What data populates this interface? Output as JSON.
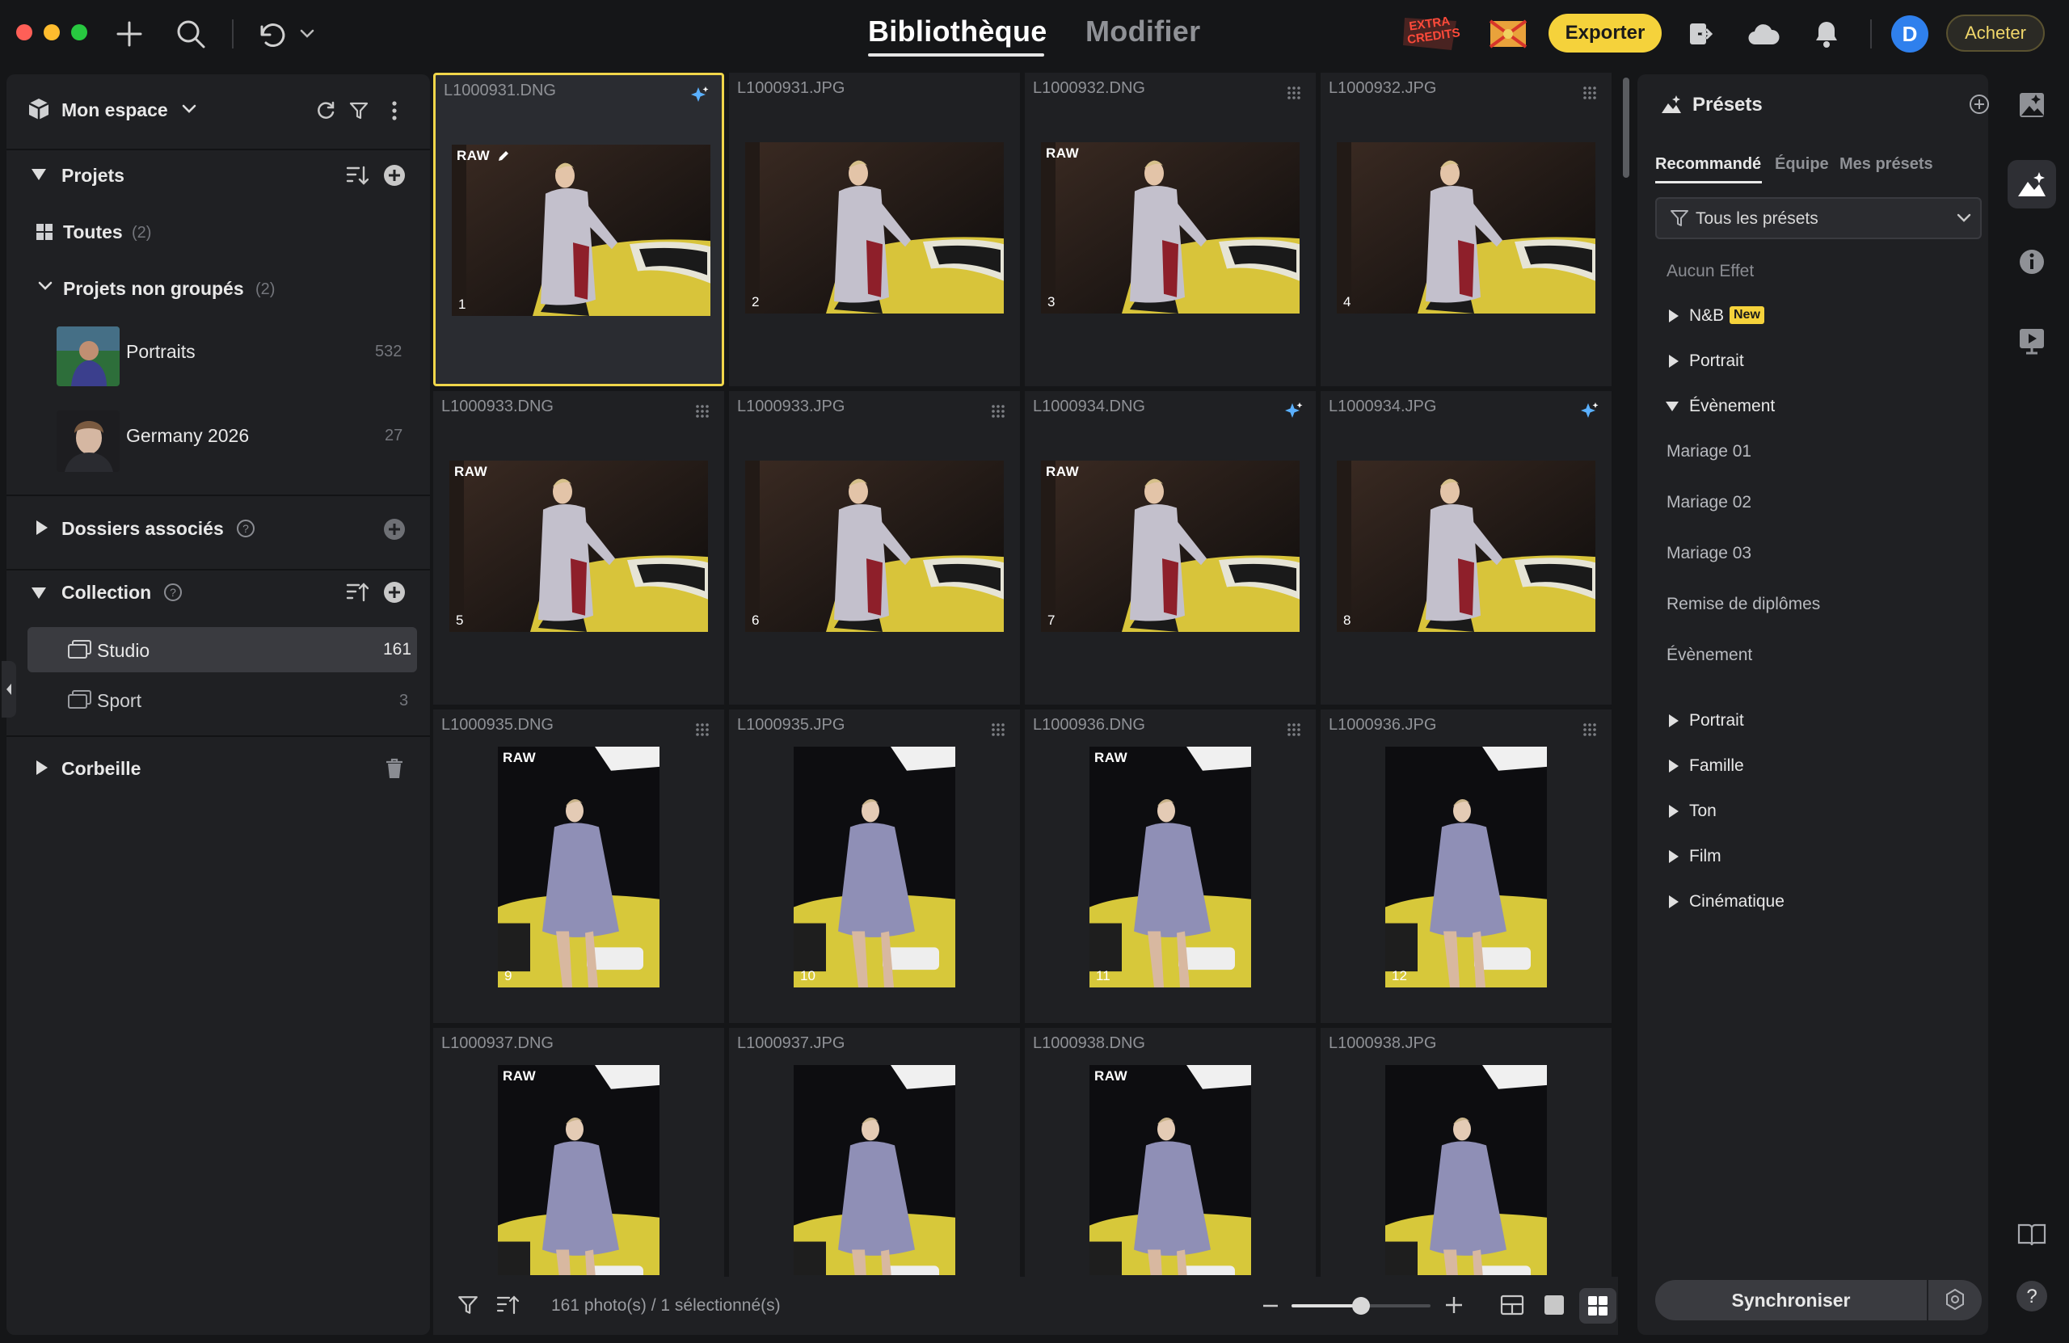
{
  "header": {
    "tab_library": "Bibliothèque",
    "tab_edit": "Modifier",
    "promo_badge": "EXTRA CREDITS",
    "export_label": "Exporter",
    "avatar_initial": "D",
    "buy_label": "Acheter"
  },
  "left": {
    "workspace": "Mon espace",
    "projects": "Projets",
    "all": "Toutes",
    "all_count": "(2)",
    "ungrouped": "Projets non groupés",
    "ungrouped_count": "(2)",
    "project_items": [
      {
        "name": "Portraits",
        "count": "532"
      },
      {
        "name": "Germany 2026",
        "count": "27"
      }
    ],
    "linked_folders": "Dossiers associés",
    "collection": "Collection",
    "collection_items": [
      {
        "name": "Studio",
        "count": "161"
      },
      {
        "name": "Sport",
        "count": "3"
      }
    ],
    "trash": "Corbeille"
  },
  "grid": {
    "raw_label": "RAW",
    "cells": [
      {
        "file": "L1000931.DNG",
        "num": "1"
      },
      {
        "file": "L1000931.JPG",
        "num": "2"
      },
      {
        "file": "L1000932.DNG",
        "num": "3"
      },
      {
        "file": "L1000932.JPG",
        "num": "4"
      },
      {
        "file": "L1000933.DNG",
        "num": "5"
      },
      {
        "file": "L1000933.JPG",
        "num": "6"
      },
      {
        "file": "L1000934.DNG",
        "num": "7"
      },
      {
        "file": "L1000934.JPG",
        "num": "8"
      },
      {
        "file": "L1000935.DNG",
        "num": "9"
      },
      {
        "file": "L1000935.JPG",
        "num": "10"
      },
      {
        "file": "L1000936.DNG",
        "num": "11"
      },
      {
        "file": "L1000936.JPG",
        "num": "12"
      },
      {
        "file": "L1000937.DNG",
        "num": ""
      },
      {
        "file": "L1000937.JPG",
        "num": ""
      },
      {
        "file": "L1000938.DNG",
        "num": ""
      },
      {
        "file": "L1000938.JPG",
        "num": ""
      }
    ]
  },
  "footer": {
    "status": "161 photo(s) / 1 sélectionné(s)",
    "zoom_level": 0.5
  },
  "presets": {
    "title": "Présets",
    "tab_recommended": "Recommandé",
    "tab_team": "Équipe",
    "tab_mine": "Mes présets",
    "filter": "Tous les présets",
    "no_effect": "Aucun Effet",
    "nb": "N&B",
    "new_badge": "New",
    "portrait": "Portrait",
    "event": "Évènement",
    "event_items": [
      "Mariage 01",
      "Mariage 02",
      "Mariage 03",
      "Remise de diplômes",
      "Évènement"
    ],
    "groups": [
      "Portrait",
      "Famille",
      "Ton",
      "Film",
      "Cinématique"
    ],
    "sync": "Synchroniser"
  }
}
